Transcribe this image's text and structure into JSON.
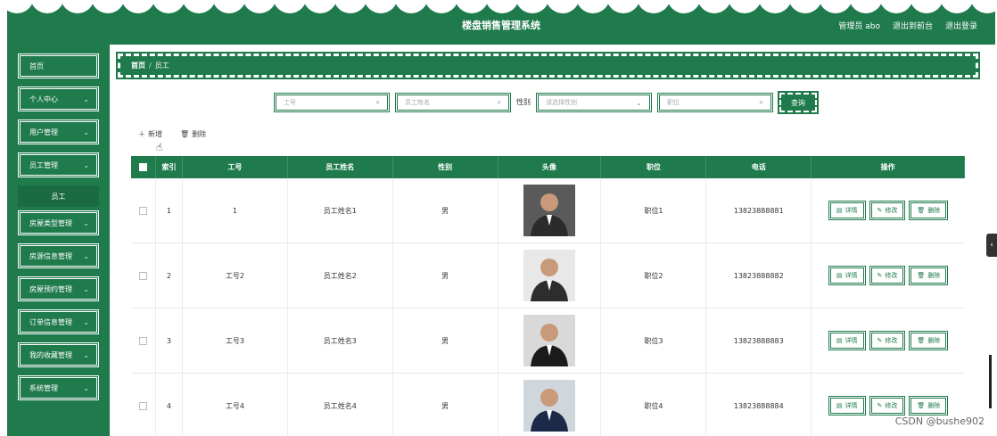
{
  "header": {
    "title": "楼盘销售管理系统",
    "admin": "管理员 abo",
    "to_front": "退出到前台",
    "logout": "退出登录"
  },
  "sidebar": {
    "items": [
      {
        "label": "首页",
        "has_chevron": false
      },
      {
        "label": "个人中心",
        "has_chevron": true
      },
      {
        "label": "用户管理",
        "has_chevron": true
      },
      {
        "label": "员工管理",
        "has_chevron": true,
        "expanded": true
      },
      {
        "label": "房屋类型管理",
        "has_chevron": true
      },
      {
        "label": "房源信息管理",
        "has_chevron": true
      },
      {
        "label": "房屋预约管理",
        "has_chevron": true
      },
      {
        "label": "订单信息管理",
        "has_chevron": true
      },
      {
        "label": "我的收藏管理",
        "has_chevron": true
      },
      {
        "label": "系统管理",
        "has_chevron": true
      }
    ],
    "submenu": {
      "label": "员工"
    }
  },
  "breadcrumb": {
    "home": "首页",
    "separator": "/",
    "current": "员工"
  },
  "search": {
    "employee_no_placeholder": "工号",
    "employee_name_placeholder": "员工姓名",
    "gender_label": "性别",
    "gender_placeholder": "请选择性别",
    "position_placeholder": "职位",
    "query_button": "查询"
  },
  "actions": {
    "add": "新增",
    "delete": "删除"
  },
  "table": {
    "headers": [
      "索引",
      "工号",
      "员工姓名",
      "性别",
      "头像",
      "职位",
      "电话",
      "操作"
    ],
    "rows": [
      {
        "index": "1",
        "no": "1",
        "name": "员工姓名1",
        "gender": "男",
        "position": "职位1",
        "phone": "13823888881"
      },
      {
        "index": "2",
        "no": "工号2",
        "name": "员工姓名2",
        "gender": "男",
        "position": "职位2",
        "phone": "13823888882"
      },
      {
        "index": "3",
        "no": "工号3",
        "name": "员工姓名3",
        "gender": "男",
        "position": "职位3",
        "phone": "13823888883"
      },
      {
        "index": "4",
        "no": "工号4",
        "name": "员工姓名4",
        "gender": "男",
        "position": "职位4",
        "phone": "13823888884"
      }
    ],
    "ops": {
      "detail": "详情",
      "edit": "修改",
      "delete": "删除"
    }
  },
  "colors": {
    "primary": "#1f7a4c",
    "white": "#ffffff"
  },
  "watermark": "CSDN @bushe902"
}
